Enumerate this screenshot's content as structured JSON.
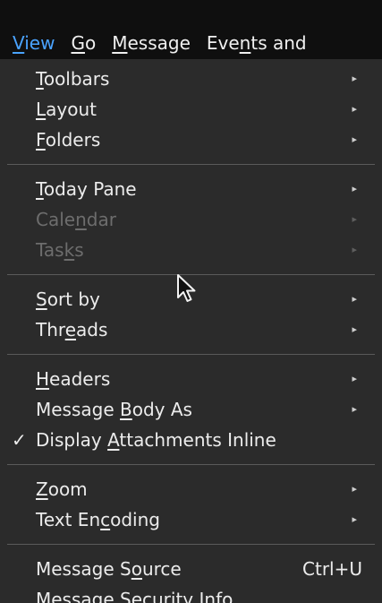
{
  "menubar": {
    "items": [
      {
        "label": "View",
        "u": "V",
        "rest": "iew",
        "pre": ""
      },
      {
        "label": "Go",
        "u": "G",
        "rest": "o",
        "pre": ""
      },
      {
        "label": "Message",
        "u": "M",
        "rest": "essage",
        "pre": ""
      },
      {
        "label": "Events and",
        "pre": "Eve",
        "u": "n",
        "rest": "ts and"
      }
    ]
  },
  "menu": {
    "toolbars": {
      "pre": "",
      "u": "T",
      "rest": "oolbars"
    },
    "layout": {
      "pre": "",
      "u": "L",
      "rest": "ayout"
    },
    "folders": {
      "pre": "",
      "u": "F",
      "rest": "olders"
    },
    "today_pane": {
      "pre": "",
      "u": "T",
      "rest": "oday Pane"
    },
    "calendar": {
      "pre": "Cale",
      "u": "n",
      "rest": "dar"
    },
    "tasks": {
      "pre": "Tas",
      "u": "k",
      "rest": "s"
    },
    "sort_by": {
      "pre": "",
      "u": "S",
      "rest": "ort by"
    },
    "threads": {
      "pre": "Thr",
      "u": "e",
      "rest": "ads"
    },
    "headers": {
      "pre": "",
      "u": "H",
      "rest": "eaders"
    },
    "message_body_as": {
      "pre": "Message ",
      "u": "B",
      "rest": "ody As"
    },
    "display_attachments_inline": {
      "pre": "Display ",
      "u": "A",
      "rest": "ttachments Inline",
      "check": "✓"
    },
    "zoom": {
      "pre": "",
      "u": "Z",
      "rest": "oom"
    },
    "text_encoding": {
      "pre": "Text En",
      "u": "c",
      "rest": "oding"
    },
    "message_source": {
      "pre": "Message S",
      "u": "o",
      "rest": "urce",
      "shortcut": "Ctrl+U"
    },
    "message_security_info": {
      "pre": "Message Security ",
      "u": "I",
      "rest": "nfo"
    }
  },
  "submenu_arrow": "▸",
  "icons": {
    "cursor": "mouse-pointer-icon",
    "submenu": "submenu-arrow-icon",
    "check": "checkmark-icon"
  },
  "colors": {
    "menubar_bg": "#0f0f0f",
    "menu_bg": "#2b2b2b",
    "text": "#ececec",
    "disabled": "#6d6d6d",
    "accent": "#4aa3ff"
  }
}
